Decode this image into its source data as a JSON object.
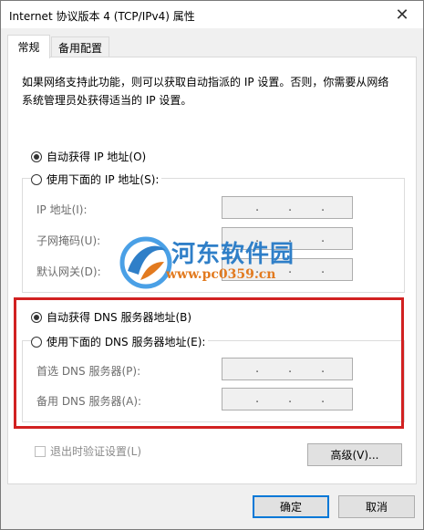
{
  "window": {
    "title": "Internet 协议版本 4 (TCP/IPv4) 属性",
    "close_glyph": "✕"
  },
  "tabs": [
    {
      "label": "常规"
    },
    {
      "label": "备用配置"
    }
  ],
  "description": "如果网络支持此功能，则可以获取自动指派的 IP 设置。否则，你需要从网络系统管理员处获得适当的 IP 设置。",
  "ip": {
    "auto_label": "自动获得 IP 地址(O)",
    "auto_selected": true,
    "manual_label": "使用下面的 IP 地址(S):",
    "fields": [
      {
        "label": "IP 地址(I):",
        "value": ". . ."
      },
      {
        "label": "子网掩码(U):",
        "value": ". . ."
      },
      {
        "label": "默认网关(D):",
        "value": ". . ."
      }
    ]
  },
  "dns": {
    "auto_label": "自动获得 DNS 服务器地址(B)",
    "auto_selected": true,
    "manual_label": "使用下面的 DNS 服务器地址(E):",
    "fields": [
      {
        "label": "首选 DNS 服务器(P):",
        "value": ". . ."
      },
      {
        "label": "备用 DNS 服务器(A):",
        "value": ". . ."
      }
    ]
  },
  "validate_label": "退出时验证设置(L)",
  "buttons": {
    "advanced": "高级(V)...",
    "ok": "确定",
    "cancel": "取消"
  },
  "watermark": {
    "line1": "河东软件园",
    "line2": "www.pc0359.cn"
  },
  "colors": {
    "highlight": "#d12121",
    "accent": "#0078d7"
  }
}
